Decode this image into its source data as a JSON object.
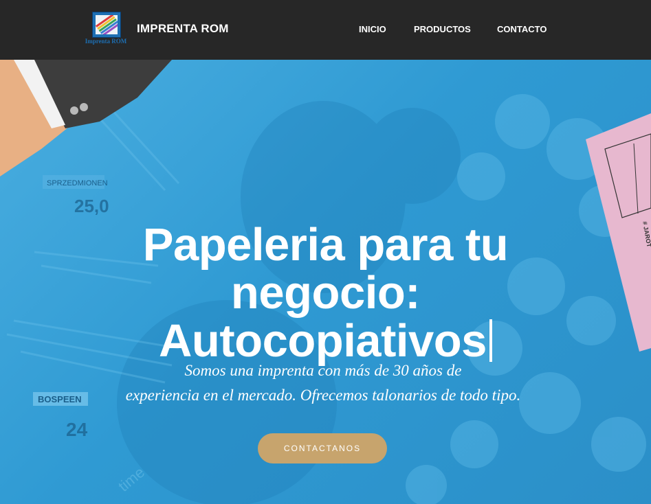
{
  "header": {
    "logo_caption": "Imprenta ROM",
    "brand_name": "IMPRENTA ROM",
    "nav": [
      {
        "label": "INICIO"
      },
      {
        "label": "PRODUCTOS"
      },
      {
        "label": "CONTACTO"
      }
    ]
  },
  "hero": {
    "headline_line1": "Papeleria para tu",
    "headline_line2": "negocio:",
    "headline_line3": "Autocopiativos",
    "subtitle_line1": "Somos una imprenta con más de 30 años de",
    "subtitle_line2": "experiencia en el mercado. Ofrecemos talonarios de todo tipo.",
    "cta_label": "CONTACTANOS",
    "background_labels": {
      "sign1": "SPRZEDMIONEN",
      "price1": "25,0",
      "sign2": "BOSPEEN",
      "price2": "24",
      "receipt_text": "# JAROT",
      "apron_text": "time"
    }
  },
  "colors": {
    "navbar": "#272727",
    "hero_blue": "#2f9ad3",
    "cta": "#c7a46d",
    "receipt_pink": "#e7b8cf",
    "skin": "#e8b084",
    "suit": "#3d3d3d"
  },
  "icons": [
    "logo-icon",
    "text-cursor-icon"
  ]
}
